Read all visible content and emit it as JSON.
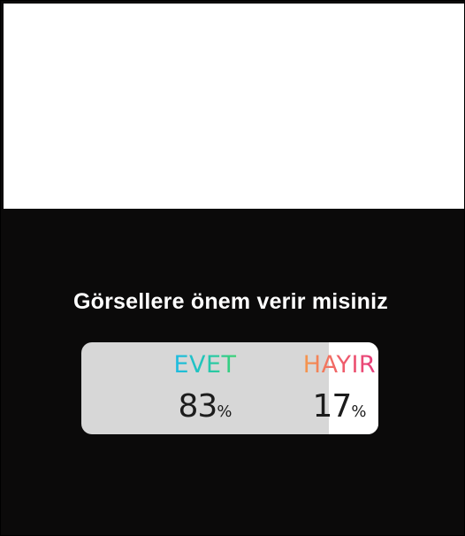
{
  "story": {
    "question": "Görsellere önem verir misiniz"
  },
  "poll": {
    "options": [
      {
        "label": "EVET",
        "percent_value": "83",
        "percent_sign": "%",
        "share": 0.83
      },
      {
        "label": "HAYIR",
        "percent_value": "17",
        "percent_sign": "%",
        "share": 0.17
      }
    ],
    "colors": {
      "background": "#d7d7d7",
      "winner_fill": "#ffffff",
      "yes_gradient": [
        "#1eb9e9",
        "#3fd36b"
      ],
      "no_gradient": [
        "#f59a4b",
        "#e63a7b"
      ]
    }
  }
}
